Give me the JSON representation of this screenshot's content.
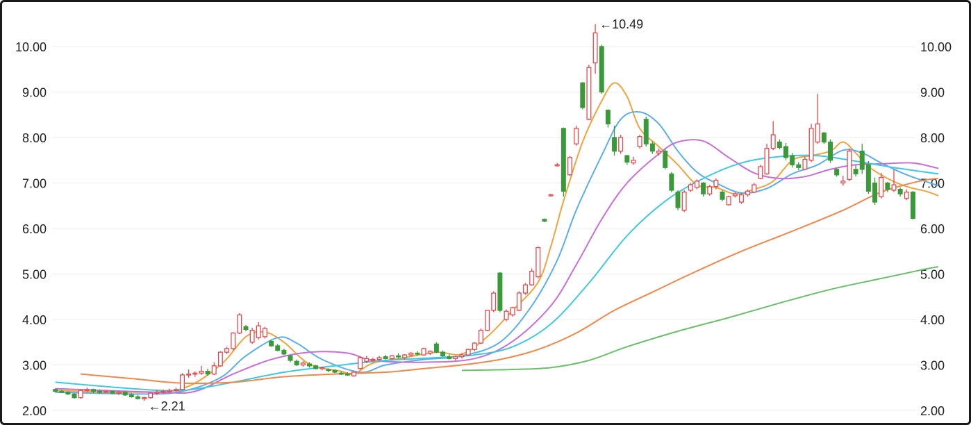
{
  "chart_data": {
    "type": "candlestick",
    "y_axis_left": {
      "ticks": [
        "2.00",
        "3.00",
        "4.00",
        "5.00",
        "6.00",
        "7.00",
        "8.00",
        "9.00",
        "10.00"
      ]
    },
    "y_axis_right": {
      "ticks": [
        "2.00",
        "3.00",
        "4.00",
        "5.00",
        "6.00",
        "7.00",
        "8.00",
        "9.00",
        "10.00"
      ]
    },
    "ylim": [
      1.95,
      10.55
    ],
    "grid": true,
    "annotations": {
      "high": "10.49",
      "low": "2.21"
    },
    "colors": {
      "up": "#e5484d",
      "down": "#3a9a3a"
    },
    "ohlc": [
      [
        2.46,
        2.48,
        2.4,
        2.42
      ],
      [
        2.42,
        2.45,
        2.38,
        2.4
      ],
      [
        2.4,
        2.42,
        2.34,
        2.36
      ],
      [
        2.36,
        2.38,
        2.26,
        2.28
      ],
      [
        2.28,
        2.46,
        2.26,
        2.44
      ],
      [
        2.44,
        2.5,
        2.4,
        2.46
      ],
      [
        2.46,
        2.48,
        2.38,
        2.42
      ],
      [
        2.42,
        2.46,
        2.36,
        2.4
      ],
      [
        2.4,
        2.44,
        2.38,
        2.42
      ],
      [
        2.42,
        2.44,
        2.36,
        2.38
      ],
      [
        2.38,
        2.42,
        2.34,
        2.4
      ],
      [
        2.4,
        2.42,
        2.32,
        2.34
      ],
      [
        2.34,
        2.38,
        2.28,
        2.3
      ],
      [
        2.3,
        2.34,
        2.24,
        2.26
      ],
      [
        2.26,
        2.3,
        2.21,
        2.28
      ],
      [
        2.28,
        2.4,
        2.26,
        2.38
      ],
      [
        2.38,
        2.44,
        2.34,
        2.4
      ],
      [
        2.4,
        2.46,
        2.36,
        2.42
      ],
      [
        2.42,
        2.48,
        2.38,
        2.44
      ],
      [
        2.44,
        2.5,
        2.4,
        2.46
      ],
      [
        2.46,
        2.82,
        2.44,
        2.78
      ],
      [
        2.78,
        2.9,
        2.72,
        2.8
      ],
      [
        2.8,
        2.86,
        2.74,
        2.82
      ],
      [
        2.82,
        2.98,
        2.78,
        2.86
      ],
      [
        2.86,
        2.92,
        2.76,
        2.8
      ],
      [
        2.8,
        3.06,
        2.78,
        2.98
      ],
      [
        2.98,
        3.3,
        2.96,
        3.28
      ],
      [
        3.28,
        3.4,
        3.24,
        3.36
      ],
      [
        3.36,
        3.72,
        3.32,
        3.7
      ],
      [
        3.7,
        4.14,
        3.68,
        4.1
      ],
      [
        3.84,
        3.88,
        3.74,
        3.78
      ],
      [
        3.5,
        3.82,
        3.46,
        3.76
      ],
      [
        3.6,
        3.94,
        3.56,
        3.86
      ],
      [
        3.62,
        3.84,
        3.58,
        3.8
      ],
      [
        3.52,
        3.56,
        3.4,
        3.42
      ],
      [
        3.42,
        3.46,
        3.3,
        3.32
      ],
      [
        3.32,
        3.36,
        3.22,
        3.24
      ],
      [
        3.2,
        3.22,
        3.06,
        3.1
      ],
      [
        3.08,
        3.12,
        2.98,
        3.0
      ],
      [
        3.0,
        3.08,
        2.96,
        3.04
      ],
      [
        3.02,
        3.06,
        2.94,
        2.98
      ],
      [
        2.98,
        3.0,
        2.9,
        2.92
      ],
      [
        2.92,
        2.96,
        2.88,
        2.94
      ],
      [
        2.9,
        2.92,
        2.84,
        2.88
      ],
      [
        2.88,
        2.9,
        2.82,
        2.84
      ],
      [
        2.82,
        2.86,
        2.78,
        2.8
      ],
      [
        2.8,
        2.84,
        2.76,
        2.78
      ],
      [
        2.76,
        2.86,
        2.74,
        2.84
      ],
      [
        2.92,
        3.2,
        2.9,
        3.16
      ],
      [
        3.08,
        3.2,
        3.04,
        3.14
      ],
      [
        3.1,
        3.16,
        3.06,
        3.12
      ],
      [
        3.12,
        3.2,
        3.08,
        3.16
      ],
      [
        3.18,
        3.22,
        3.12,
        3.14
      ],
      [
        3.14,
        3.22,
        3.1,
        3.2
      ],
      [
        3.2,
        3.26,
        3.14,
        3.18
      ],
      [
        3.16,
        3.24,
        3.12,
        3.22
      ],
      [
        3.22,
        3.28,
        3.18,
        3.26
      ],
      [
        3.26,
        3.3,
        3.2,
        3.24
      ],
      [
        3.22,
        3.38,
        3.2,
        3.36
      ],
      [
        3.26,
        3.32,
        3.22,
        3.3
      ],
      [
        3.46,
        3.5,
        3.26,
        3.28
      ],
      [
        3.28,
        3.32,
        3.18,
        3.2
      ],
      [
        3.18,
        3.24,
        3.12,
        3.14
      ],
      [
        3.14,
        3.2,
        3.1,
        3.18
      ],
      [
        3.18,
        3.26,
        3.14,
        3.22
      ],
      [
        3.22,
        3.36,
        3.2,
        3.34
      ],
      [
        3.34,
        3.5,
        3.3,
        3.48
      ],
      [
        3.48,
        3.8,
        3.46,
        3.76
      ],
      [
        3.76,
        4.2,
        3.74,
        4.2
      ],
      [
        4.2,
        4.62,
        4.16,
        4.58
      ],
      [
        5.02,
        5.04,
        4.16,
        4.2
      ],
      [
        4.0,
        4.22,
        3.96,
        4.18
      ],
      [
        4.1,
        4.28,
        4.06,
        4.26
      ],
      [
        4.2,
        4.62,
        4.18,
        4.58
      ],
      [
        4.58,
        4.8,
        4.54,
        4.76
      ],
      [
        4.76,
        5.12,
        4.74,
        5.06
      ],
      [
        4.94,
        5.6,
        4.9,
        5.58
      ],
      [
        6.2,
        6.22,
        6.14,
        6.16
      ],
      [
        6.72,
        6.76,
        6.7,
        6.74
      ],
      [
        7.4,
        7.44,
        7.36,
        7.4
      ],
      [
        8.2,
        8.22,
        6.7,
        6.82
      ],
      [
        7.18,
        7.6,
        7.16,
        7.56
      ],
      [
        7.86,
        8.26,
        7.82,
        8.2
      ],
      [
        9.2,
        9.22,
        8.62,
        8.66
      ],
      [
        8.4,
        9.6,
        8.38,
        9.54
      ],
      [
        9.64,
        10.49,
        9.4,
        10.3
      ],
      [
        10.0,
        10.04,
        8.96,
        9.0
      ],
      [
        8.6,
        8.62,
        8.22,
        8.3
      ],
      [
        8.0,
        8.26,
        7.6,
        7.7
      ],
      [
        7.7,
        8.06,
        7.64,
        8.0
      ],
      [
        7.6,
        7.62,
        7.4,
        7.46
      ],
      [
        7.44,
        7.58,
        7.4,
        7.5
      ],
      [
        7.8,
        8.06,
        7.76,
        8.02
      ],
      [
        8.4,
        8.46,
        7.8,
        7.86
      ],
      [
        7.86,
        7.92,
        7.64,
        7.7
      ],
      [
        7.66,
        7.76,
        7.6,
        7.7
      ],
      [
        7.7,
        7.74,
        7.3,
        7.34
      ],
      [
        7.2,
        7.24,
        6.8,
        6.84
      ],
      [
        6.8,
        6.84,
        6.4,
        6.46
      ],
      [
        6.4,
        6.84,
        6.36,
        6.8
      ],
      [
        6.84,
        7.0,
        6.8,
        6.96
      ],
      [
        6.9,
        7.08,
        6.86,
        7.04
      ],
      [
        7.0,
        7.02,
        6.7,
        6.76
      ],
      [
        6.76,
        6.96,
        6.72,
        6.92
      ],
      [
        6.92,
        7.1,
        6.86,
        7.06
      ],
      [
        6.8,
        6.84,
        6.6,
        6.64
      ],
      [
        6.52,
        6.72,
        6.5,
        6.7
      ],
      [
        6.72,
        6.8,
        6.68,
        6.76
      ],
      [
        6.58,
        6.78,
        6.54,
        6.74
      ],
      [
        6.74,
        6.86,
        6.7,
        6.82
      ],
      [
        6.8,
        7.0,
        6.78,
        6.96
      ],
      [
        7.1,
        7.4,
        7.08,
        7.36
      ],
      [
        7.2,
        7.86,
        7.18,
        7.76
      ],
      [
        7.76,
        8.36,
        7.72,
        8.06
      ],
      [
        7.9,
        7.96,
        7.74,
        7.78
      ],
      [
        7.8,
        7.88,
        7.5,
        7.56
      ],
      [
        7.6,
        7.66,
        7.34,
        7.4
      ],
      [
        7.4,
        7.46,
        7.28,
        7.34
      ],
      [
        7.3,
        7.58,
        7.28,
        7.52
      ],
      [
        7.5,
        8.3,
        7.46,
        8.2
      ],
      [
        7.9,
        8.96,
        7.86,
        8.3
      ],
      [
        8.1,
        8.12,
        7.86,
        7.9
      ],
      [
        7.9,
        7.96,
        7.44,
        7.5
      ],
      [
        7.3,
        7.32,
        7.14,
        7.18
      ],
      [
        7.0,
        7.16,
        6.94,
        7.04
      ],
      [
        7.08,
        7.76,
        7.04,
        7.7
      ],
      [
        7.3,
        7.4,
        7.14,
        7.2
      ],
      [
        7.7,
        7.86,
        7.2,
        7.3
      ],
      [
        7.4,
        7.48,
        6.76,
        6.82
      ],
      [
        7.0,
        7.12,
        6.52,
        6.58
      ],
      [
        6.7,
        7.22,
        6.66,
        7.12
      ],
      [
        7.0,
        7.02,
        6.8,
        6.86
      ],
      [
        6.84,
        7.3,
        6.8,
        6.96
      ],
      [
        6.86,
        6.9,
        6.7,
        6.76
      ],
      [
        6.66,
        6.86,
        6.62,
        6.8
      ],
      [
        6.8,
        6.82,
        6.2,
        6.22
      ]
    ],
    "moving_averages": [
      {
        "color": "#f2a33c",
        "values": [
          [
            0,
            2.44
          ],
          [
            12,
            2.4
          ],
          [
            20,
            2.48
          ],
          [
            26,
            3.0
          ],
          [
            30,
            3.62
          ],
          [
            33,
            3.72
          ],
          [
            36,
            3.5
          ],
          [
            40,
            3.02
          ],
          [
            45,
            2.86
          ],
          [
            47,
            2.8
          ],
          [
            50,
            3.04
          ],
          [
            55,
            3.16
          ],
          [
            60,
            3.28
          ],
          [
            64,
            3.24
          ],
          [
            68,
            3.62
          ],
          [
            72,
            4.2
          ],
          [
            76,
            4.82
          ],
          [
            78,
            5.6
          ],
          [
            80,
            6.6
          ],
          [
            83,
            7.9
          ],
          [
            86,
            8.8
          ],
          [
            88,
            9.2
          ],
          [
            90,
            8.9
          ],
          [
            92,
            8.2
          ],
          [
            95,
            7.8
          ],
          [
            98,
            7.4
          ],
          [
            101,
            6.96
          ],
          [
            104,
            6.9
          ],
          [
            107,
            6.76
          ],
          [
            110,
            6.86
          ],
          [
            113,
            7.04
          ],
          [
            116,
            7.5
          ],
          [
            119,
            7.6
          ],
          [
            122,
            7.7
          ],
          [
            124,
            7.9
          ],
          [
            126,
            7.66
          ],
          [
            128,
            7.36
          ],
          [
            131,
            7.1
          ],
          [
            134,
            6.92
          ],
          [
            137,
            6.82
          ],
          [
            139,
            6.72
          ]
        ]
      },
      {
        "color": "#5aaef0",
        "values": [
          [
            0,
            2.4
          ],
          [
            14,
            2.36
          ],
          [
            20,
            2.42
          ],
          [
            26,
            2.72
          ],
          [
            30,
            3.2
          ],
          [
            35,
            3.6
          ],
          [
            38,
            3.48
          ],
          [
            42,
            3.12
          ],
          [
            48,
            2.84
          ],
          [
            52,
            3.0
          ],
          [
            58,
            3.12
          ],
          [
            64,
            3.2
          ],
          [
            70,
            3.5
          ],
          [
            75,
            4.3
          ],
          [
            79,
            5.3
          ],
          [
            82,
            6.4
          ],
          [
            86,
            7.6
          ],
          [
            89,
            8.4
          ],
          [
            92,
            8.56
          ],
          [
            95,
            8.3
          ],
          [
            98,
            7.7
          ],
          [
            101,
            7.24
          ],
          [
            104,
            7.0
          ],
          [
            108,
            6.78
          ],
          [
            112,
            6.88
          ],
          [
            116,
            7.2
          ],
          [
            120,
            7.4
          ],
          [
            124,
            7.72
          ],
          [
            127,
            7.66
          ],
          [
            130,
            7.44
          ],
          [
            134,
            7.18
          ],
          [
            139,
            6.94
          ]
        ]
      },
      {
        "color": "#c86ed6",
        "values": [
          [
            0,
            2.48
          ],
          [
            16,
            2.4
          ],
          [
            22,
            2.42
          ],
          [
            28,
            2.8
          ],
          [
            34,
            3.12
          ],
          [
            40,
            3.28
          ],
          [
            46,
            3.26
          ],
          [
            50,
            3.1
          ],
          [
            58,
            3.06
          ],
          [
            66,
            3.14
          ],
          [
            72,
            3.52
          ],
          [
            78,
            4.3
          ],
          [
            82,
            5.2
          ],
          [
            86,
            6.2
          ],
          [
            90,
            7.0
          ],
          [
            95,
            7.64
          ],
          [
            98,
            7.9
          ],
          [
            102,
            7.92
          ],
          [
            106,
            7.56
          ],
          [
            110,
            7.22
          ],
          [
            114,
            7.1
          ],
          [
            118,
            7.14
          ],
          [
            122,
            7.3
          ],
          [
            126,
            7.4
          ],
          [
            130,
            7.42
          ],
          [
            135,
            7.44
          ],
          [
            139,
            7.32
          ]
        ]
      },
      {
        "color": "#3ec9e0",
        "values": [
          [
            0,
            2.62
          ],
          [
            12,
            2.48
          ],
          [
            20,
            2.44
          ],
          [
            28,
            2.62
          ],
          [
            36,
            2.84
          ],
          [
            44,
            2.98
          ],
          [
            52,
            3.1
          ],
          [
            60,
            3.16
          ],
          [
            66,
            3.22
          ],
          [
            72,
            3.4
          ],
          [
            78,
            3.9
          ],
          [
            84,
            4.8
          ],
          [
            90,
            5.84
          ],
          [
            96,
            6.6
          ],
          [
            102,
            7.1
          ],
          [
            108,
            7.44
          ],
          [
            114,
            7.58
          ],
          [
            120,
            7.6
          ],
          [
            126,
            7.48
          ],
          [
            132,
            7.34
          ],
          [
            139,
            7.2
          ]
        ]
      },
      {
        "color": "#f2874a",
        "values": [
          [
            4,
            2.8
          ],
          [
            12,
            2.7
          ],
          [
            20,
            2.6
          ],
          [
            28,
            2.62
          ],
          [
            36,
            2.74
          ],
          [
            44,
            2.8
          ],
          [
            52,
            2.84
          ],
          [
            58,
            2.92
          ],
          [
            64,
            3.0
          ],
          [
            70,
            3.12
          ],
          [
            76,
            3.34
          ],
          [
            82,
            3.7
          ],
          [
            88,
            4.2
          ],
          [
            94,
            4.6
          ],
          [
            100,
            5.0
          ],
          [
            108,
            5.5
          ],
          [
            116,
            5.94
          ],
          [
            124,
            6.4
          ],
          [
            130,
            6.8
          ],
          [
            136,
            7.04
          ],
          [
            139,
            7.1
          ]
        ]
      },
      {
        "color": "#6bbf6b",
        "values": [
          [
            64,
            2.88
          ],
          [
            72,
            2.9
          ],
          [
            78,
            2.94
          ],
          [
            84,
            3.1
          ],
          [
            90,
            3.4
          ],
          [
            98,
            3.74
          ],
          [
            106,
            4.04
          ],
          [
            114,
            4.36
          ],
          [
            122,
            4.66
          ],
          [
            130,
            4.9
          ],
          [
            136,
            5.08
          ],
          [
            139,
            5.16
          ]
        ]
      }
    ]
  }
}
